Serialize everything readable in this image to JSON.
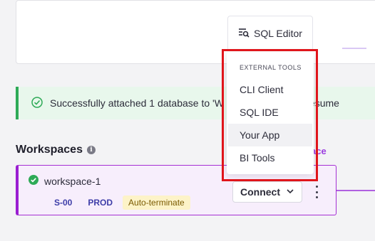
{
  "toolbar": {
    "sql_editor_label": "SQL Editor"
  },
  "banner": {
    "message": "Successfully attached 1 database to 'W",
    "message_tail": "esume"
  },
  "workspaces": {
    "title": "Workspaces",
    "link_fragment": "ace",
    "items": [
      {
        "name": "workspace-1",
        "size": "S-00",
        "env": "PROD",
        "badge": "Auto-terminate",
        "connect_label": "Connect",
        "status_color": "#2eaa57"
      }
    ]
  },
  "menu": {
    "heading": "EXTERNAL TOOLS",
    "items": [
      "CLI Client",
      "SQL IDE",
      "Your App",
      "BI Tools"
    ],
    "hovered": "Your App"
  },
  "colors": {
    "accent": "#9a1ed1",
    "success": "#2eaa57",
    "highlight": "#e0151b"
  }
}
